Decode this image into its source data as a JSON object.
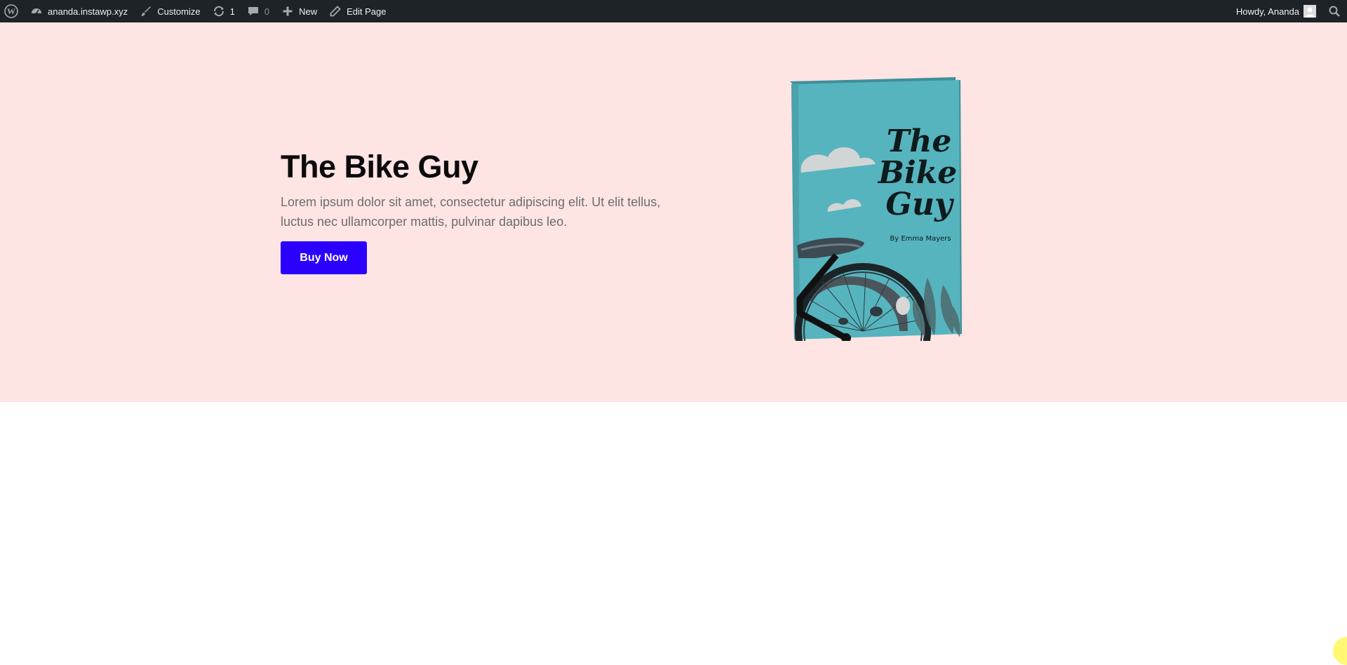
{
  "adminbar": {
    "site_name": "ananda.instawp.xyz",
    "customize": "Customize",
    "updates_count": "1",
    "comments_count": "0",
    "new_label": "New",
    "edit_page": "Edit Page",
    "howdy": "Howdy, Ananda",
    "icons": [
      "wordpress-icon",
      "dashboard-icon",
      "brush-icon",
      "updates-icon",
      "comment-icon",
      "plus-icon",
      "pencil-icon",
      "search-icon"
    ]
  },
  "hero": {
    "title": "The Bike Guy",
    "description": "Lorem ipsum dolor sit amet, consectetur adipiscing elit. Ut elit tellus, luctus nec ullamcorper mattis, pulvinar dapibus leo.",
    "button_label": "Buy Now",
    "background_color": "#ffe4e4",
    "button_color": "#2b00ff"
  },
  "book": {
    "title_line1": "The",
    "title_line2": "Bike",
    "title_line3": "Guy",
    "author": "By Emma Mayers",
    "cover_color": "#56b4be"
  }
}
